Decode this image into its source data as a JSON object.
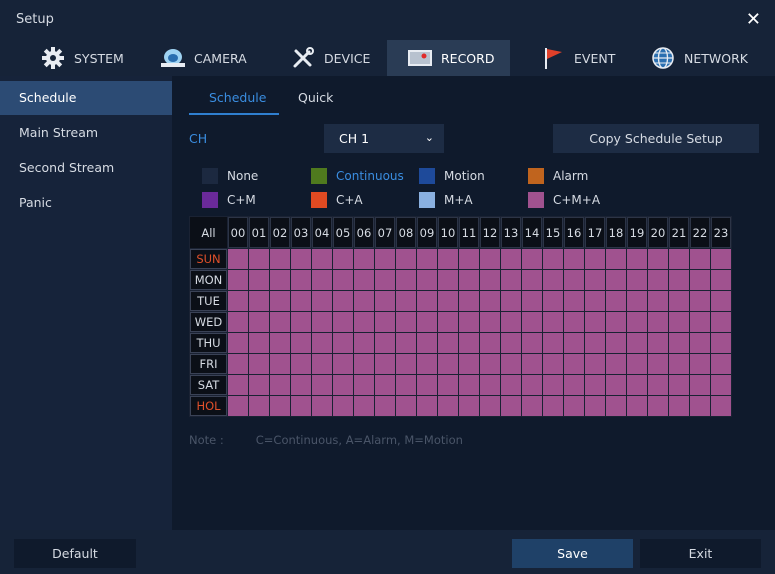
{
  "window": {
    "title": "Setup",
    "close": "✕"
  },
  "tabs": [
    {
      "label": "SYSTEM",
      "icon": "gear-icon"
    },
    {
      "label": "CAMERA",
      "icon": "camera-icon"
    },
    {
      "label": "DEVICE",
      "icon": "tools-icon"
    },
    {
      "label": "RECORD",
      "icon": "record-icon",
      "active": true
    },
    {
      "label": "EVENT",
      "icon": "flag-icon"
    },
    {
      "label": "NETWORK",
      "icon": "globe-icon"
    }
  ],
  "sidebar": {
    "items": [
      {
        "label": "Schedule",
        "active": true
      },
      {
        "label": "Main Stream"
      },
      {
        "label": "Second Stream"
      },
      {
        "label": "Panic"
      }
    ]
  },
  "subtabs": [
    {
      "label": "Schedule",
      "active": true
    },
    {
      "label": "Quick"
    }
  ],
  "channel": {
    "label": "CH",
    "value": "CH 1"
  },
  "copy_button": "Copy Schedule Setup",
  "legend": [
    {
      "label": "None",
      "color": "#1c2940"
    },
    {
      "label": "Continuous",
      "color": "#4f7a1e"
    },
    {
      "label": "Motion",
      "color": "#1e4a9a"
    },
    {
      "label": "Alarm",
      "color": "#c0641e"
    },
    {
      "label": "C+M",
      "color": "#6a2a9a"
    },
    {
      "label": "C+A",
      "color": "#e04a22"
    },
    {
      "label": "M+A",
      "color": "#8ab0e0"
    },
    {
      "label": "C+M+A",
      "color": "#a0528f"
    }
  ],
  "grid": {
    "all_label": "All",
    "hours": [
      "00",
      "01",
      "02",
      "03",
      "04",
      "05",
      "06",
      "07",
      "08",
      "09",
      "10",
      "11",
      "12",
      "13",
      "14",
      "15",
      "16",
      "17",
      "18",
      "19",
      "20",
      "21",
      "22",
      "23"
    ],
    "days": [
      "SUN",
      "MON",
      "TUE",
      "WED",
      "THU",
      "FRI",
      "SAT",
      "HOL"
    ],
    "cell_mode": "C+M+A"
  },
  "note": {
    "label": "Note :",
    "text": "C=Continuous, A=Alarm, M=Motion"
  },
  "footer": {
    "default": "Default",
    "save": "Save",
    "exit": "Exit"
  }
}
